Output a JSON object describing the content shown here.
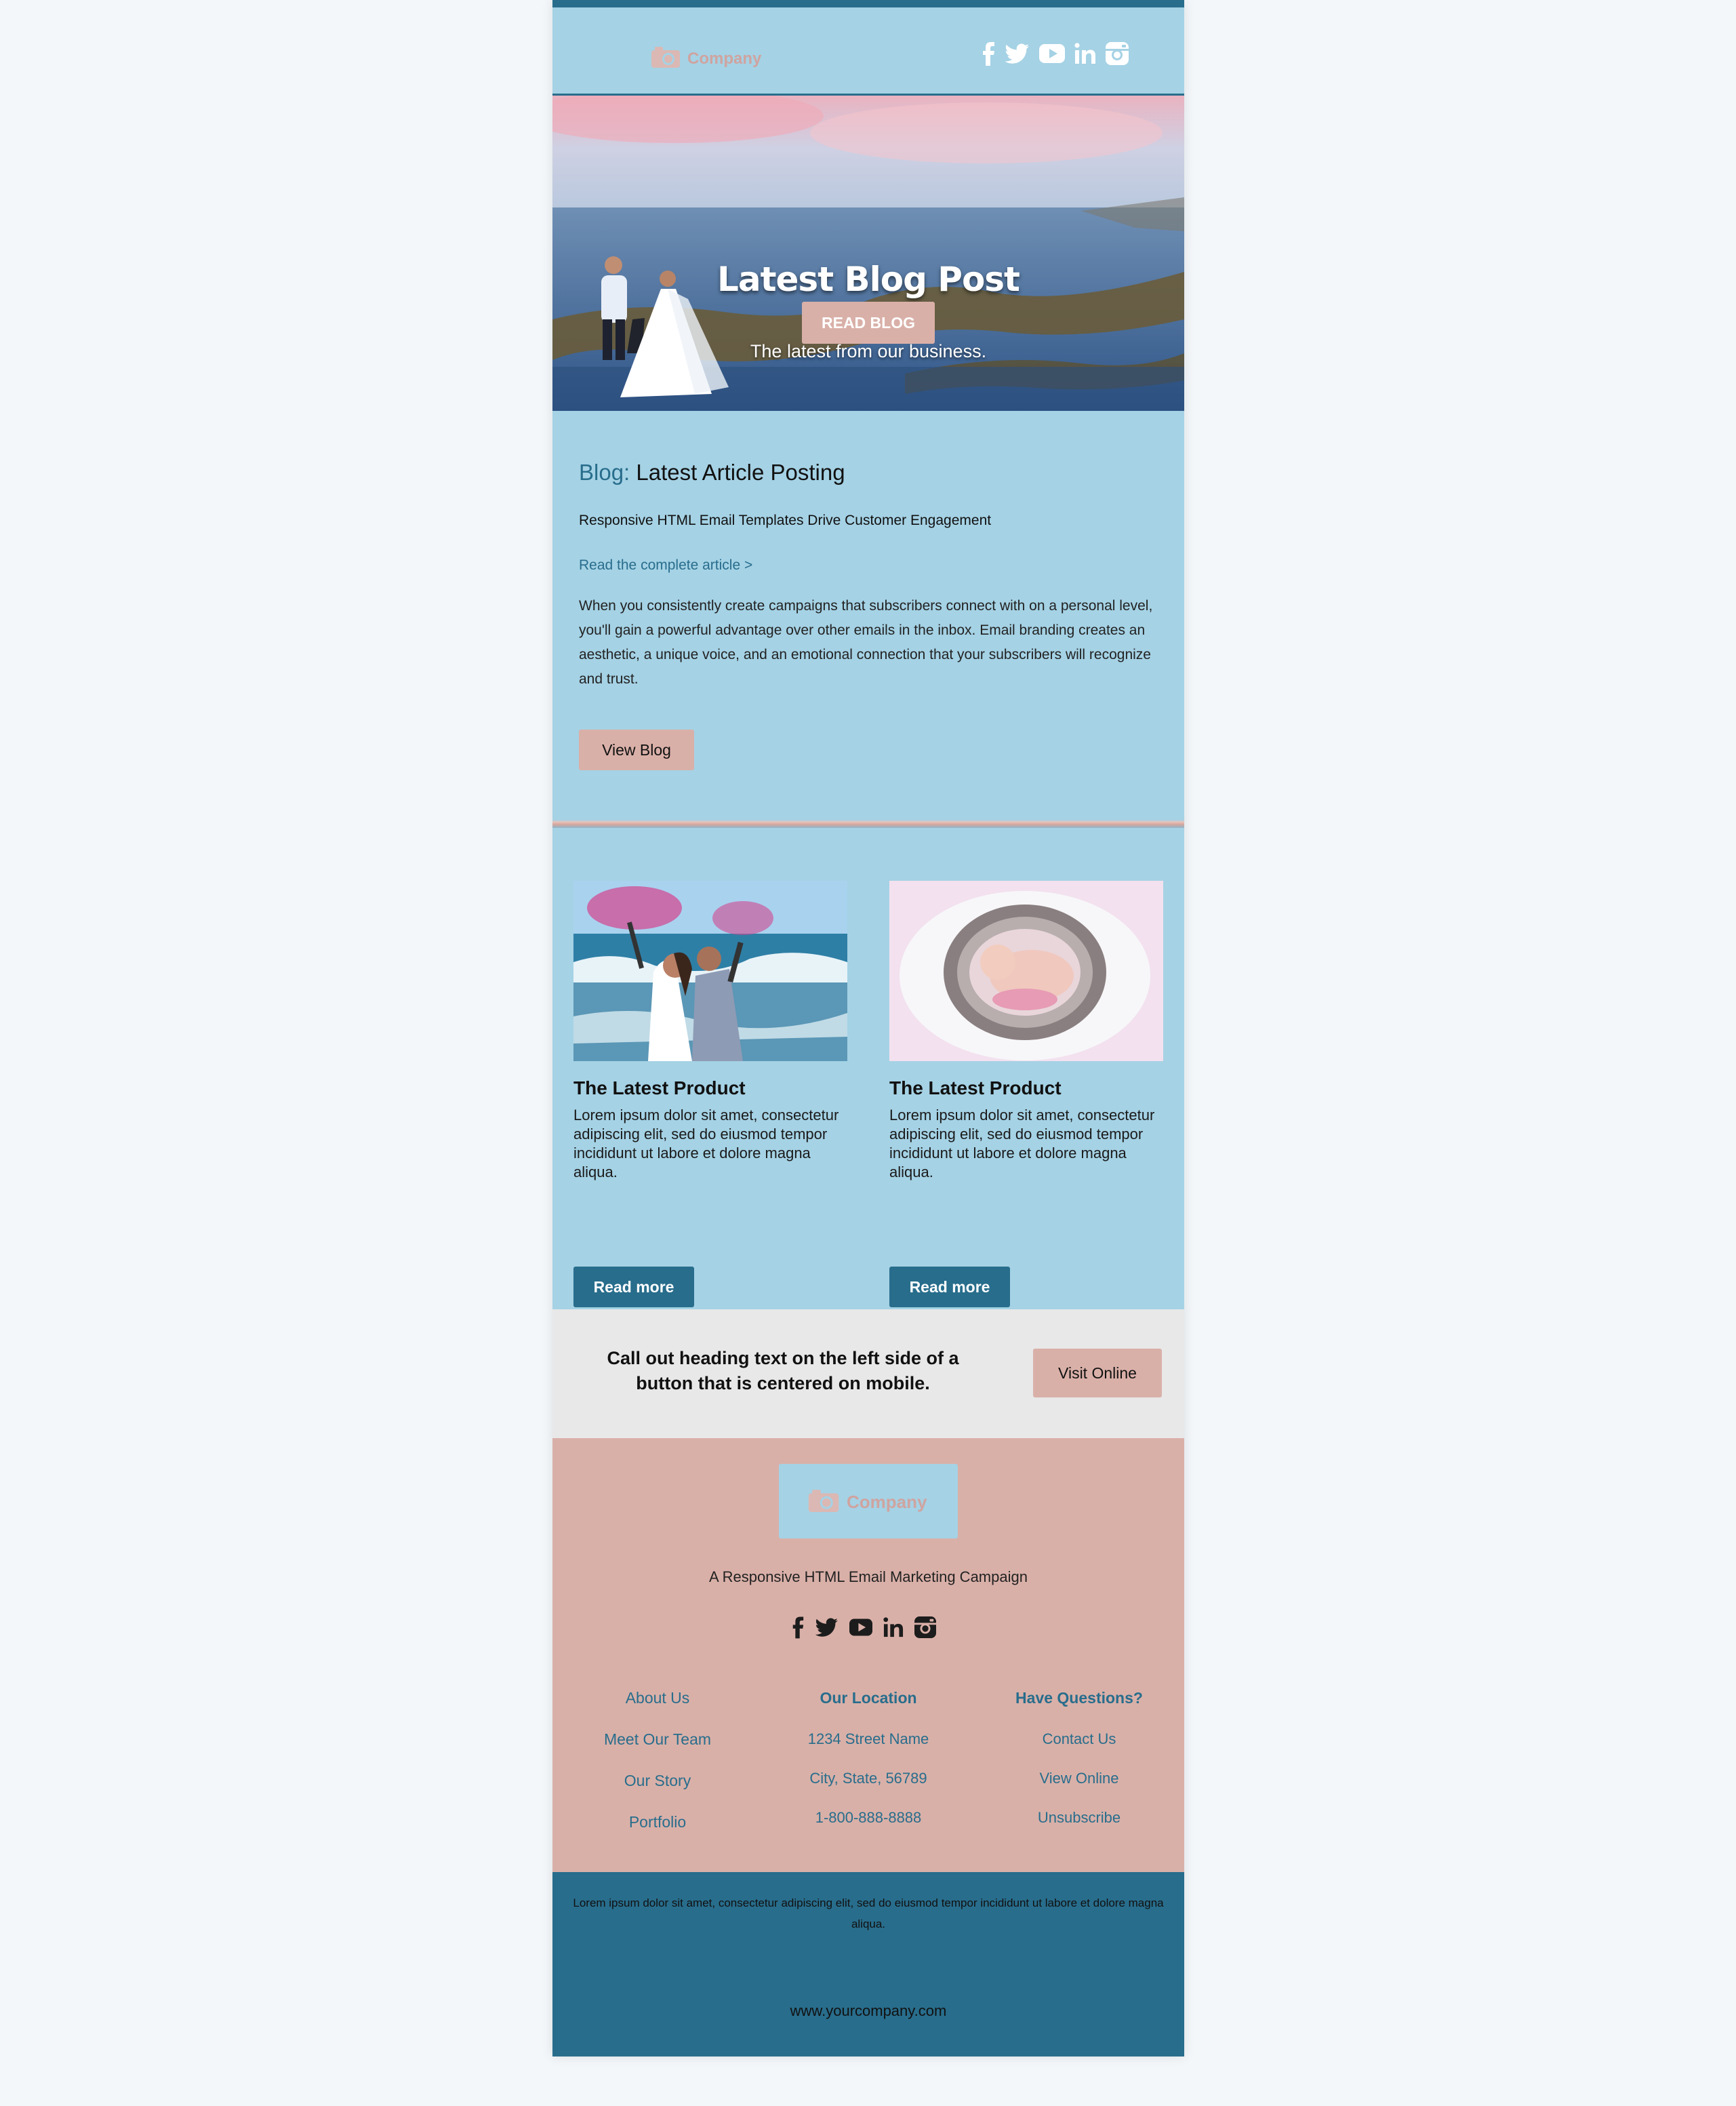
{
  "header": {
    "logo_text": "Company",
    "social_icons": [
      "facebook-icon",
      "twitter-icon",
      "youtube-icon",
      "linkedin-icon",
      "instagram-icon"
    ]
  },
  "hero": {
    "title": "Latest Blog Post",
    "subtitle": "The latest from our business.",
    "button_label": "READ BLOG"
  },
  "blog": {
    "heading_keyword": "Blog:",
    "heading_text": "Latest Article Posting",
    "subtitle": "Responsive HTML Email Templates Drive Customer Engagement",
    "link_text": "Read the complete article >",
    "body": "When you consistently create campaigns that subscribers connect with on a personal level, you'll gain a powerful advantage over other emails in the inbox. Email branding creates an aesthetic, a unique voice, and an emotional connection that your subscribers will recognize and trust.",
    "button_label": "View Blog"
  },
  "products": [
    {
      "title": "The Latest Product",
      "description": "Lorem ipsum dolor sit amet, consectetur adipiscing elit, sed do eiusmod tempor incididunt ut labore et dolore magna aliqua.",
      "button_label": "Read more"
    },
    {
      "title": "The Latest Product",
      "description": "Lorem ipsum dolor sit amet, consectetur adipiscing elit, sed do eiusmod tempor incididunt ut labore et dolore magna aliqua.",
      "button_label": "Read more"
    }
  ],
  "callout": {
    "text": "Call out heading text on the left side of a button that is centered on mobile.",
    "button_label": "Visit Online"
  },
  "footer": {
    "logo_text": "Company",
    "tagline": "A Responsive HTML Email Marketing Campaign",
    "columns": [
      {
        "heading": "About Us",
        "items": [
          "Meet Our Team",
          "Our Story",
          "Portfolio"
        ]
      },
      {
        "heading": "Our Location",
        "items": [
          "1234 Street Name",
          "City, State, 56789",
          "1-800-888-8888"
        ]
      },
      {
        "heading": "Have Questions?",
        "items": [
          "Contact Us",
          "View Online",
          "Unsubscribe"
        ]
      }
    ],
    "fine_print": "Lorem ipsum dolor sit amet, consectetur adipiscing elit, sed do eiusmod tempor incididunt ut labore et dolore magna aliqua.",
    "website": "www.yourcompany.com"
  },
  "colors": {
    "page_bg": "#f3f7fa",
    "light_blue": "#a5d2e5",
    "dark_teal": "#286d8c",
    "pink": "#d9b0a8",
    "callout_gray": "#e8e8e8"
  }
}
